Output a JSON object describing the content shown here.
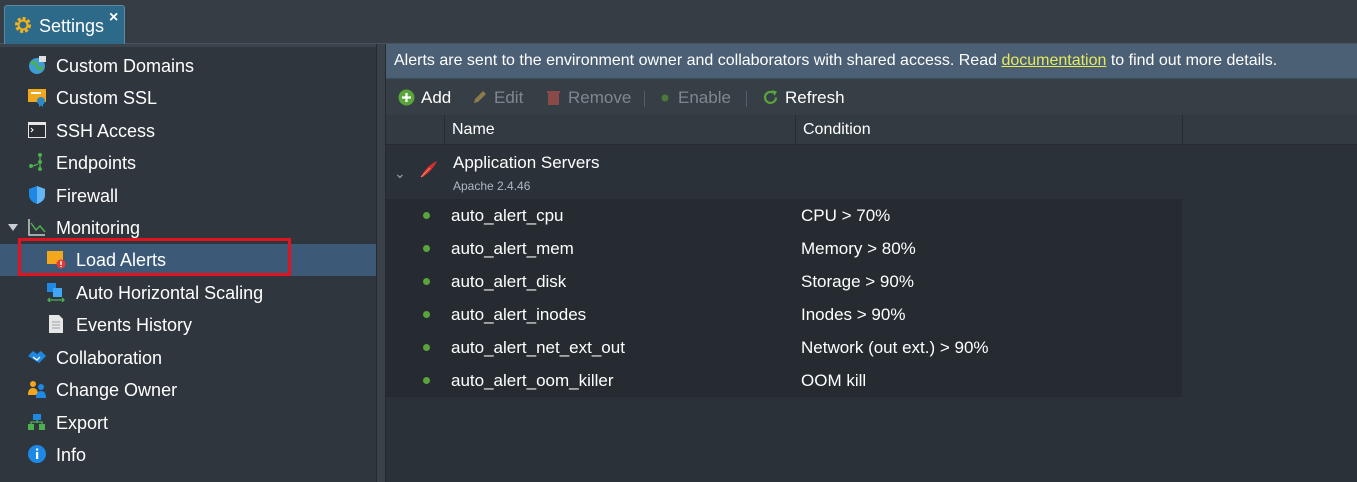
{
  "tab": {
    "label": "Settings",
    "close": "×"
  },
  "sidebar": {
    "items": [
      {
        "label": "Custom Domains"
      },
      {
        "label": "Custom SSL"
      },
      {
        "label": "SSH Access"
      },
      {
        "label": "Endpoints"
      },
      {
        "label": "Firewall"
      },
      {
        "label": "Monitoring"
      },
      {
        "label": "Load Alerts"
      },
      {
        "label": "Auto Horizontal Scaling"
      },
      {
        "label": "Events History"
      },
      {
        "label": "Collaboration"
      },
      {
        "label": "Change Owner"
      },
      {
        "label": "Export"
      },
      {
        "label": "Info"
      }
    ]
  },
  "info": {
    "text_before": "Alerts are sent to the environment owner and collaborators with shared access. Read ",
    "link": "documentation",
    "text_after": " to find out more details."
  },
  "toolbar": {
    "add": "Add",
    "edit": "Edit",
    "remove": "Remove",
    "enable": "Enable",
    "refresh": "Refresh"
  },
  "grid": {
    "columns": {
      "name": "Name",
      "condition": "Condition"
    },
    "group": {
      "title": "Application Servers",
      "subtitle": "Apache 2.4.46"
    },
    "rows": [
      {
        "name": "auto_alert_cpu",
        "condition": "CPU > 70%"
      },
      {
        "name": "auto_alert_mem",
        "condition": "Memory > 80%"
      },
      {
        "name": "auto_alert_disk",
        "condition": "Storage > 90%"
      },
      {
        "name": "auto_alert_inodes",
        "condition": "Inodes > 90%"
      },
      {
        "name": "auto_alert_net_ext_out",
        "condition": "Network (out ext.) > 90%"
      },
      {
        "name": "auto_alert_oom_killer",
        "condition": "OOM kill"
      }
    ]
  },
  "colors": {
    "selected_bg": "#3c5a78",
    "highlight": "#e0141e",
    "status_dot": "#5aa53a",
    "link": "#e6ea5a"
  }
}
